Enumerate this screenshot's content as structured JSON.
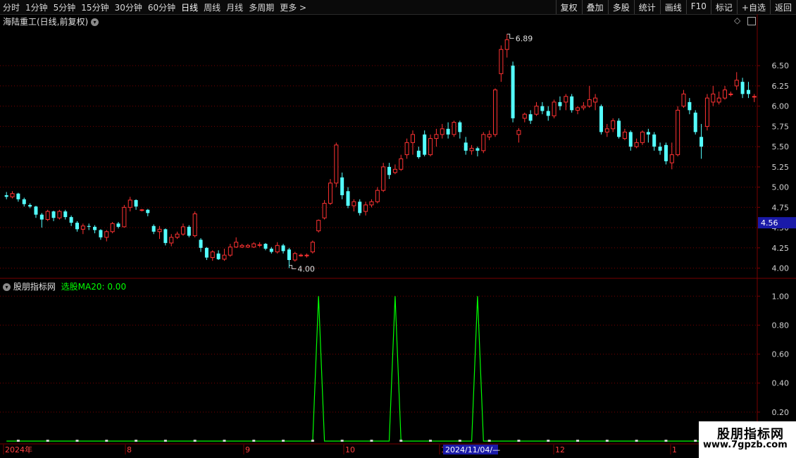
{
  "toolbar": {
    "periods": [
      "分时",
      "1分钟",
      "5分钟",
      "15分钟",
      "30分钟",
      "60分钟",
      "日线",
      "周线",
      "月线",
      "多周期",
      "更多 >"
    ],
    "active": "日线",
    "right_buttons": [
      "复权",
      "叠加",
      "多股",
      "统计",
      "画线",
      "F10",
      "标记",
      "+自选",
      "返回"
    ]
  },
  "main_title": "海陆重工(日线,前复权)",
  "indicator_title": "股朋指标网",
  "indicator_value": "选股MA20: 0.00",
  "price_axis": [
    "6.50",
    "6.25",
    "6.00",
    "5.75",
    "5.50",
    "5.25",
    "5.00",
    "4.75",
    "4.50",
    "4.25",
    "4.00"
  ],
  "indicator_axis": [
    "1.00",
    "0.80",
    "0.60",
    "0.40",
    "0.20"
  ],
  "current_price": "4.56",
  "max_label": "6.89",
  "min_label": "4.00",
  "x_labels": [
    "2024年",
    "8",
    "9",
    "10",
    "1",
    "12",
    "1"
  ],
  "cursor_date": "2024/11/04/—",
  "watermark": {
    "title": "股朋指标网",
    "url": "www.7gpzb.com"
  },
  "colors": {
    "up": "#ff3232",
    "down": "#54ffff",
    "grid": "#7a0000",
    "signal": "#00ff00"
  },
  "chart_data": {
    "type": "candlestick",
    "price_range": [
      3.9,
      6.98
    ],
    "indicator_range": [
      0,
      1.05
    ],
    "signal_spikes_at": [
      53,
      66,
      80
    ],
    "candles": [
      [
        4.9,
        4.88,
        4.94,
        4.85
      ],
      [
        4.88,
        4.92,
        4.95,
        4.86
      ],
      [
        4.92,
        4.85,
        4.93,
        4.82
      ],
      [
        4.85,
        4.79,
        4.87,
        4.76
      ],
      [
        4.78,
        4.76,
        4.8,
        4.74
      ],
      [
        4.76,
        4.66,
        4.77,
        4.62
      ],
      [
        4.66,
        4.6,
        4.68,
        4.5
      ],
      [
        4.6,
        4.7,
        4.72,
        4.58
      ],
      [
        4.7,
        4.62,
        4.71,
        4.58
      ],
      [
        4.62,
        4.7,
        4.72,
        4.6
      ],
      [
        4.7,
        4.63,
        4.72,
        4.6
      ],
      [
        4.63,
        4.56,
        4.65,
        4.52
      ],
      [
        4.56,
        4.48,
        4.58,
        4.45
      ],
      [
        4.48,
        4.52,
        4.55,
        4.42
      ],
      [
        4.52,
        4.51,
        4.55,
        4.47
      ],
      [
        4.51,
        4.47,
        4.53,
        4.43
      ],
      [
        4.47,
        4.38,
        4.48,
        4.35
      ],
      [
        4.38,
        4.45,
        4.47,
        4.33
      ],
      [
        4.45,
        4.55,
        4.57,
        4.43
      ],
      [
        4.55,
        4.51,
        4.57,
        4.49
      ],
      [
        4.51,
        4.75,
        4.78,
        4.5
      ],
      [
        4.75,
        4.84,
        4.88,
        4.7
      ],
      [
        4.84,
        4.76,
        4.85,
        4.72
      ],
      [
        4.72,
        4.72,
        4.73,
        4.7
      ],
      [
        4.72,
        4.68,
        4.73,
        4.64
      ],
      [
        4.52,
        4.45,
        4.54,
        4.42
      ],
      [
        4.45,
        4.48,
        4.52,
        4.36
      ],
      [
        4.48,
        4.31,
        4.49,
        4.28
      ],
      [
        4.31,
        4.38,
        4.42,
        4.27
      ],
      [
        4.38,
        4.42,
        4.45,
        4.36
      ],
      [
        4.42,
        4.51,
        4.55,
        4.4
      ],
      [
        4.51,
        4.4,
        4.53,
        4.38
      ],
      [
        4.4,
        4.67,
        4.7,
        4.38
      ],
      [
        4.35,
        4.25,
        4.37,
        4.2
      ],
      [
        4.25,
        4.13,
        4.26,
        4.1
      ],
      [
        4.13,
        4.2,
        4.22,
        4.09
      ],
      [
        4.18,
        4.11,
        4.22,
        4.1
      ],
      [
        4.11,
        4.16,
        4.24,
        4.09
      ],
      [
        4.16,
        4.26,
        4.3,
        4.14
      ],
      [
        4.26,
        4.32,
        4.38,
        4.25
      ],
      [
        4.26,
        4.28,
        4.3,
        4.25
      ],
      [
        4.26,
        4.28,
        4.3,
        4.25
      ],
      [
        4.26,
        4.3,
        4.32,
        4.25
      ],
      [
        4.28,
        4.29,
        4.32,
        4.26
      ],
      [
        4.3,
        4.24,
        4.31,
        4.22
      ],
      [
        4.24,
        4.2,
        4.26,
        4.18
      ],
      [
        4.2,
        4.28,
        4.32,
        4.18
      ],
      [
        4.28,
        4.21,
        4.3,
        4.18
      ],
      [
        4.23,
        4.1,
        4.25,
        4.0
      ],
      [
        4.1,
        4.18,
        4.2,
        4.08
      ],
      [
        4.16,
        4.16,
        4.18,
        4.14
      ],
      [
        4.16,
        4.16,
        4.18,
        4.13
      ],
      [
        4.2,
        4.32,
        4.34,
        4.18
      ],
      [
        4.46,
        4.59,
        4.6,
        4.44
      ],
      [
        4.62,
        4.8,
        4.84,
        4.6
      ],
      [
        4.8,
        5.05,
        5.1,
        4.78
      ],
      [
        5.05,
        5.52,
        5.55,
        5.0
      ],
      [
        5.12,
        4.9,
        5.18,
        4.85
      ],
      [
        4.95,
        4.77,
        5.0,
        4.74
      ],
      [
        4.77,
        4.82,
        4.85,
        4.7
      ],
      [
        4.82,
        4.68,
        4.85,
        4.65
      ],
      [
        4.7,
        4.78,
        4.82,
        4.65
      ],
      [
        4.78,
        4.82,
        4.85,
        4.75
      ],
      [
        4.82,
        4.96,
        5.0,
        4.8
      ],
      [
        4.96,
        5.25,
        5.3,
        4.94
      ],
      [
        5.25,
        5.15,
        5.3,
        5.1
      ],
      [
        5.18,
        5.22,
        5.28,
        5.16
      ],
      [
        5.22,
        5.35,
        5.4,
        5.2
      ],
      [
        5.4,
        5.55,
        5.6,
        5.35
      ],
      [
        5.55,
        5.65,
        5.7,
        5.4
      ],
      [
        5.45,
        5.37,
        5.5,
        5.35
      ],
      [
        5.65,
        5.4,
        5.7,
        5.38
      ],
      [
        5.4,
        5.6,
        5.65,
        5.38
      ],
      [
        5.6,
        5.65,
        5.72,
        5.5
      ],
      [
        5.65,
        5.72,
        5.78,
        5.6
      ],
      [
        5.72,
        5.65,
        5.8,
        5.6
      ],
      [
        5.65,
        5.8,
        5.82,
        5.62
      ],
      [
        5.8,
        5.68,
        5.82,
        5.6
      ],
      [
        5.55,
        5.45,
        5.62,
        5.4
      ],
      [
        5.45,
        5.48,
        5.52,
        5.4
      ],
      [
        5.48,
        5.45,
        5.5,
        5.38
      ],
      [
        5.45,
        5.65,
        5.68,
        5.42
      ],
      [
        5.62,
        5.65,
        5.7,
        5.58
      ],
      [
        5.65,
        6.2,
        6.22,
        5.62
      ],
      [
        6.4,
        6.7,
        6.75,
        6.3
      ],
      [
        6.7,
        6.82,
        6.89,
        6.6
      ],
      [
        6.5,
        5.85,
        6.55,
        5.8
      ],
      [
        5.65,
        5.7,
        5.73,
        5.55
      ],
      [
        5.85,
        5.9,
        5.92,
        5.8
      ],
      [
        5.9,
        5.82,
        5.95,
        5.78
      ],
      [
        5.9,
        6.0,
        6.05,
        5.88
      ],
      [
        6.0,
        5.94,
        6.05,
        5.9
      ],
      [
        5.94,
        5.88,
        6.0,
        5.82
      ],
      [
        5.88,
        6.05,
        6.08,
        5.85
      ],
      [
        6.05,
        6.0,
        6.12,
        5.95
      ],
      [
        6.05,
        6.12,
        6.15,
        5.95
      ],
      [
        6.12,
        5.95,
        6.15,
        5.92
      ],
      [
        5.95,
        5.98,
        6.0,
        5.9
      ],
      [
        5.98,
        6.0,
        6.05,
        5.95
      ],
      [
        6.0,
        6.08,
        6.25,
        5.98
      ],
      [
        6.05,
        6.1,
        6.15,
        5.95
      ],
      [
        6.0,
        5.68,
        6.02,
        5.65
      ],
      [
        5.68,
        5.72,
        5.78,
        5.62
      ],
      [
        5.72,
        5.82,
        5.85,
        5.68
      ],
      [
        5.82,
        5.62,
        5.85,
        5.6
      ],
      [
        5.6,
        5.68,
        5.72,
        5.58
      ],
      [
        5.68,
        5.5,
        5.7,
        5.45
      ],
      [
        5.5,
        5.55,
        5.6,
        5.48
      ],
      [
        5.55,
        5.68,
        5.7,
        5.52
      ],
      [
        5.68,
        5.65,
        5.72,
        5.55
      ],
      [
        5.65,
        5.5,
        5.68,
        5.45
      ],
      [
        5.5,
        5.45,
        5.55,
        5.4
      ],
      [
        5.52,
        5.32,
        5.55,
        5.28
      ],
      [
        5.3,
        5.4,
        5.55,
        5.22
      ],
      [
        5.4,
        5.95,
        6.0,
        5.38
      ],
      [
        6.0,
        6.15,
        6.2,
        5.98
      ],
      [
        6.05,
        5.95,
        6.1,
        5.9
      ],
      [
        5.92,
        5.68,
        5.95,
        5.65
      ],
      [
        5.62,
        5.5,
        5.78,
        5.35
      ],
      [
        5.75,
        6.1,
        6.15,
        5.7
      ],
      [
        6.05,
        6.15,
        6.25,
        6.0
      ],
      [
        6.05,
        6.1,
        6.18,
        6.02
      ],
      [
        6.1,
        6.2,
        6.25,
        6.08
      ],
      [
        6.15,
        6.15,
        6.18,
        6.12
      ],
      [
        6.25,
        6.32,
        6.42,
        6.2
      ],
      [
        6.3,
        6.15,
        6.35,
        6.1
      ],
      [
        6.2,
        6.15,
        6.3,
        6.1
      ],
      [
        6.12,
        6.12,
        6.15,
        6.05
      ]
    ]
  }
}
